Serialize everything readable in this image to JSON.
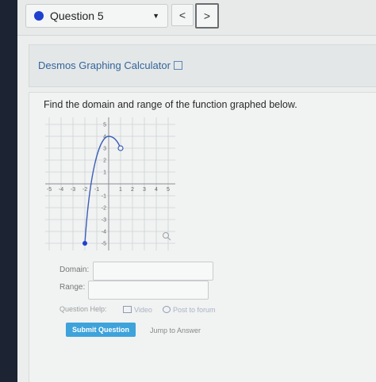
{
  "nav": {
    "question_label": "Question 5",
    "prev_glyph": "<",
    "next_glyph": ">"
  },
  "desmos": {
    "link_text": "Desmos Graphing Calculator"
  },
  "question": {
    "prompt": "Find the domain and range of the function graphed below."
  },
  "graph": {
    "x_ticks": [
      "-5",
      "-4",
      "-3",
      "-2",
      "-1",
      "1",
      "2",
      "3",
      "4",
      "5"
    ],
    "y_ticks": [
      "5",
      "4",
      "3",
      "2",
      "1",
      "-1",
      "-2",
      "-3",
      "-4",
      "-5"
    ],
    "closed_point": [
      -2,
      -5
    ],
    "open_point": [
      1,
      3
    ],
    "vertex": [
      0,
      4
    ]
  },
  "form": {
    "domain_label": "Domain:",
    "range_label": "Range:",
    "domain_value": "",
    "range_value": ""
  },
  "help": {
    "label": "Question Help:",
    "video": "Video",
    "forum": "Post to forum"
  },
  "actions": {
    "submit": "Submit Question",
    "jump": "Jump to Answer"
  },
  "colors": {
    "accent": "#3ea3da",
    "dot": "#1f3fcf",
    "curve": "#3a5fb8"
  }
}
